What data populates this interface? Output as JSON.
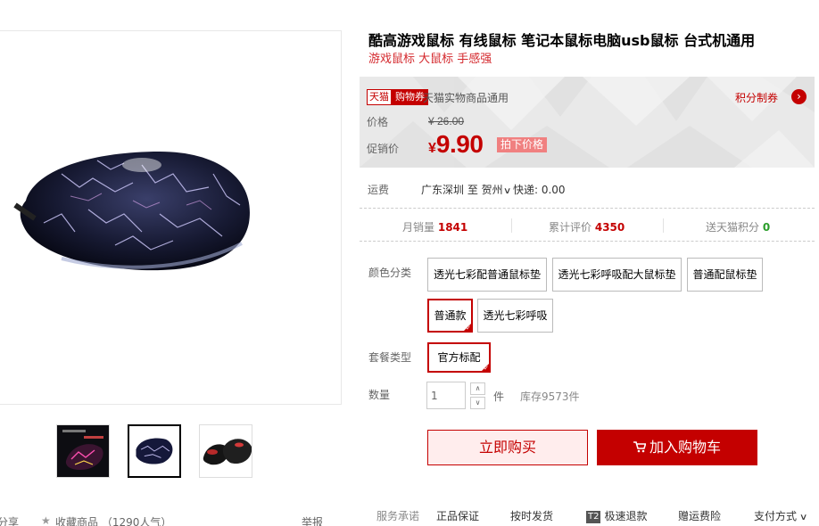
{
  "product": {
    "title": "酷高游戏鼠标 有线鼠标 笔记本鼠标电脑usb鼠标 台式机通用",
    "subtitle": "游戏鼠标 大鼠标 手感强"
  },
  "price_panel": {
    "badge_a": "天猫",
    "badge_b": "购物券",
    "coupon_text": "天猫实物商品通用",
    "points_link": "积分制券",
    "price_label": "价格",
    "original_price": "¥ 26.00",
    "promo_label": "促销价",
    "currency": "¥",
    "promo_price": "9.90",
    "promo_tag": "拍下价格"
  },
  "shipping": {
    "label": "运费",
    "value": "广东深圳 至 贺州",
    "express": "快递: 0.00"
  },
  "stats": {
    "monthly_label": "月销量",
    "monthly_value": "1841",
    "reviews_label": "累计评价",
    "reviews_value": "4350",
    "points_label": "送天猫积分",
    "points_value": "0"
  },
  "sku": {
    "color_label": "颜色分类",
    "colors": [
      "透光七彩配普通鼠标垫",
      "透光七彩呼吸配大鼠标垫",
      "普通配鼠标垫",
      "普通款",
      "透光七彩呼吸"
    ],
    "package_label": "套餐类型",
    "package_option": "官方标配",
    "selected_color": "普通款"
  },
  "quantity": {
    "label": "数量",
    "value": "1",
    "unit": "件",
    "stock": "库存9573件"
  },
  "actions": {
    "buy_now": "立即购买",
    "add_cart": "加入购物车"
  },
  "services": {
    "label": "服务承诺",
    "items": [
      "正品保证",
      "按时发货",
      "极速退款",
      "赠运费险",
      "支付方式"
    ],
    "t2_badge": "T2"
  },
  "gallery_footer": {
    "share": "分享",
    "favorite": "收藏商品 （1290人气）",
    "report": "举报"
  },
  "colors": {
    "brand_red": "#c40000",
    "accent_green": "#2a9d2a",
    "price_bg": "#e9e9e9"
  }
}
